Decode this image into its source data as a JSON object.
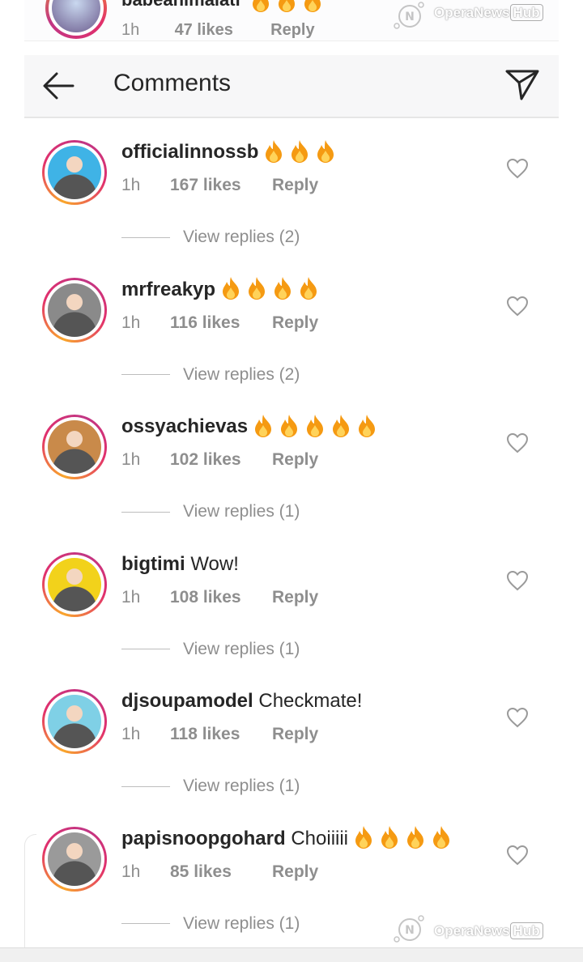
{
  "top_fragment": {
    "username": "babeanimalati",
    "time": "1h",
    "likes": "47 likes",
    "reply": "Reply",
    "fire_count": 3
  },
  "header": {
    "title": "Comments",
    "back_icon": "arrow-left-icon",
    "send_icon": "paper-plane-icon"
  },
  "watermark": {
    "text": "OperaNews",
    "box": "Hub"
  },
  "comments": [
    {
      "username": "officialinnossb",
      "message": "",
      "fire_count": 3,
      "time": "1h",
      "likes": "167 likes",
      "reply": "Reply",
      "view_replies": "View replies (2)",
      "avatar_color": "#3fb3e6"
    },
    {
      "username": "mrfreakyp",
      "message": "",
      "fire_count": 4,
      "time": "1h",
      "likes": "116 likes",
      "reply": "Reply",
      "view_replies": "View replies (2)",
      "avatar_color": "#8a8a8a"
    },
    {
      "username": "ossyachievas",
      "message": "",
      "fire_count": 5,
      "time": "1h",
      "likes": "102 likes",
      "reply": "Reply",
      "view_replies": "View replies (1)",
      "avatar_color": "#c98a4a"
    },
    {
      "username": "bigtimi",
      "message": "Wow!",
      "fire_count": 0,
      "time": "1h",
      "likes": "108 likes",
      "reply": "Reply",
      "view_replies": "View replies (1)",
      "avatar_color": "#f2d21b"
    },
    {
      "username": "djsoupamodel",
      "message": "Checkmate!",
      "fire_count": 0,
      "time": "1h",
      "likes": "118 likes",
      "reply": "Reply",
      "view_replies": "View replies (1)",
      "avatar_color": "#7fd0e6"
    },
    {
      "username": "papisnoopgohard",
      "message": "Choiiiii",
      "fire_count": 4,
      "time": "1h",
      "likes": "85 likes",
      "reply": "Reply",
      "view_replies": "View replies (1)",
      "avatar_color": "#9a9a9a"
    }
  ]
}
